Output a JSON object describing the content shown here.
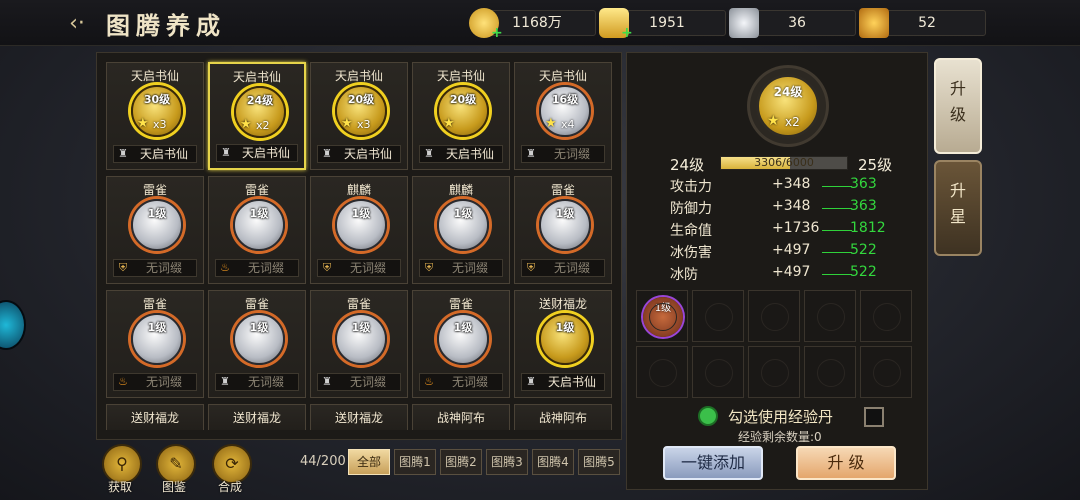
{
  "header": {
    "title": "图腾养成",
    "back_icon": "back-arrow-icon"
  },
  "resources": [
    {
      "name": "gold-coin-icon",
      "value": "1168万",
      "plus": "+"
    },
    {
      "name": "gold-ingot-icon",
      "value": "1951",
      "plus": "+"
    },
    {
      "name": "silver-item-icon",
      "value": "36"
    },
    {
      "name": "gold-item-icon",
      "value": "52"
    }
  ],
  "grid": [
    [
      {
        "name": "天启书仙",
        "level": "30级",
        "stars": "x3",
        "frame": "gold",
        "ring": "gold",
        "bar_text": "天启书仙",
        "bar_icon": "tower",
        "active": true
      },
      {
        "name": "天启书仙",
        "level": "24级",
        "stars": "x2",
        "frame": "gold",
        "ring": "gold",
        "bar_text": "天启书仙",
        "bar_icon": "tower",
        "active": true,
        "selected": true
      },
      {
        "name": "天启书仙",
        "level": "20级",
        "stars": "x3",
        "frame": "gold",
        "ring": "gold",
        "bar_text": "天启书仙",
        "bar_icon": "tower",
        "active": true
      },
      {
        "name": "天启书仙",
        "level": "20级",
        "stars": "",
        "frame": "gold",
        "ring": "gold",
        "bar_text": "天启书仙",
        "bar_icon": "tower",
        "active": true
      },
      {
        "name": "天启书仙",
        "level": "16级",
        "stars": "x4",
        "frame": "silver",
        "ring": "orange",
        "bar_text": "无词缀",
        "bar_icon": "tower",
        "active": false
      }
    ],
    [
      {
        "name": "雷雀",
        "level": "1级",
        "frame": "silver",
        "ring": "orange",
        "bar_text": "无词缀",
        "bar_icon": "shield",
        "active": false
      },
      {
        "name": "雷雀",
        "level": "1级",
        "frame": "silver",
        "ring": "orange",
        "bar_text": "无词缀",
        "bar_icon": "drop",
        "active": false
      },
      {
        "name": "麒麟",
        "level": "1级",
        "frame": "silver",
        "ring": "orange",
        "bar_text": "无词缀",
        "bar_icon": "shield",
        "active": false
      },
      {
        "name": "麒麟",
        "level": "1级",
        "frame": "silver",
        "ring": "orange",
        "bar_text": "无词缀",
        "bar_icon": "shield",
        "active": false
      },
      {
        "name": "雷雀",
        "level": "1级",
        "frame": "silver",
        "ring": "orange",
        "bar_text": "无词缀",
        "bar_icon": "shield",
        "active": false
      }
    ],
    [
      {
        "name": "雷雀",
        "level": "1级",
        "frame": "silver",
        "ring": "orange",
        "bar_text": "无词缀",
        "bar_icon": "drop",
        "active": false
      },
      {
        "name": "雷雀",
        "level": "1级",
        "frame": "silver",
        "ring": "orange",
        "bar_text": "无词缀",
        "bar_icon": "tower",
        "active": false
      },
      {
        "name": "雷雀",
        "level": "1级",
        "frame": "silver",
        "ring": "orange",
        "bar_text": "无词缀",
        "bar_icon": "tower",
        "active": false
      },
      {
        "name": "雷雀",
        "level": "1级",
        "frame": "silver",
        "ring": "orange",
        "bar_text": "无词缀",
        "bar_icon": "drop",
        "active": false
      },
      {
        "name": "送财福龙",
        "level": "1级",
        "frame": "gold",
        "ring": "gold",
        "bar_text": "天启书仙",
        "bar_icon": "tower",
        "active": true
      }
    ]
  ],
  "row4": [
    "送财福龙",
    "送财福龙",
    "送财福龙",
    "战神阿布",
    "战神阿布"
  ],
  "detail": {
    "level": "24级",
    "stars": "x2",
    "current_level": "24级",
    "next_level": "25级",
    "xp_text": "3306/6000",
    "xp_fraction": 0.551,
    "stats": [
      {
        "name": "攻击力",
        "value": "+348",
        "next": "363"
      },
      {
        "name": "防御力",
        "value": "+348",
        "next": "363"
      },
      {
        "name": "生命值",
        "value": "+1736",
        "next": "1812"
      },
      {
        "name": "冰伤害",
        "value": "+497",
        "next": "522"
      },
      {
        "name": "冰防",
        "value": "+497",
        "next": "522"
      }
    ],
    "material_slot": {
      "level": "1级"
    },
    "exp_option": "勾选使用经验丹",
    "exp_remaining": "经验剩余数量:0",
    "btn_add_all": "一键添加",
    "btn_upgrade": "升 级"
  },
  "side_tabs": [
    {
      "label1": "升",
      "label2": "级",
      "active": true
    },
    {
      "label1": "升",
      "label2": "星",
      "active": false
    }
  ],
  "bottom": {
    "buttons": [
      {
        "icon": "obtain-icon",
        "glyph": "⚲",
        "label": "获取"
      },
      {
        "icon": "book-icon",
        "glyph": "✎",
        "label": "图鉴"
      },
      {
        "icon": "merge-icon",
        "glyph": "⟳",
        "label": "合成"
      }
    ],
    "count": "44/200",
    "filters": [
      "全部",
      "图腾1",
      "图腾2",
      "图腾3",
      "图腾4",
      "图腾5"
    ]
  }
}
